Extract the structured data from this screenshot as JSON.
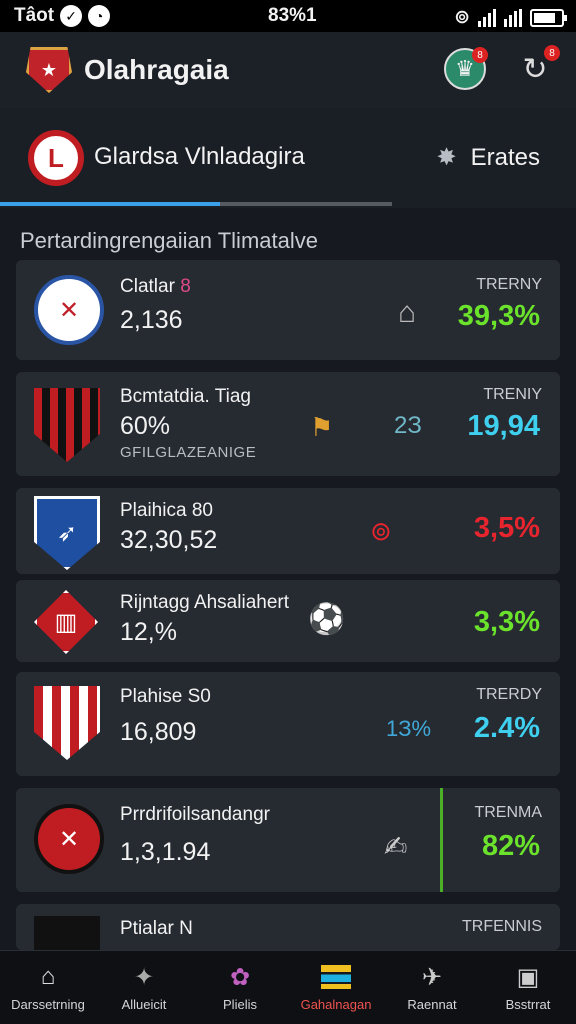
{
  "status": {
    "left_text": "Tâot",
    "time": "83%1"
  },
  "app": {
    "title": "Olahragaia"
  },
  "league": {
    "logo_letter": "L",
    "name": "Glardsa Vlnladagira",
    "extra_label": "Erates"
  },
  "section": {
    "title": "Pertardingrengaiian Tlimatalve"
  },
  "teams": [
    {
      "name": "Clatlar",
      "name_num": "8",
      "value": "2,136",
      "sub": "",
      "mid": "",
      "trend_label": "TRERNY",
      "trend_value": "39,3%",
      "trend_color": "#6be22b"
    },
    {
      "name": "Bcmtatdia. Tiag",
      "name_num": "",
      "value": "60%",
      "sub": "GFILGLAZEANIGE",
      "mid": "2З",
      "trend_label": "TRENIY",
      "trend_value": "19,94",
      "trend_color": "#3fd0f0"
    },
    {
      "name": "Plaihica",
      "name_num": "80",
      "value": "32,30,52",
      "sub": "",
      "mid": "",
      "trend_label": "",
      "trend_value": "3,5%",
      "trend_color": "#e8242e"
    },
    {
      "name": "Rijntagg Ahsaliahert",
      "name_num": "",
      "value": "12,%",
      "sub": "",
      "mid": "",
      "trend_label": "",
      "trend_value": "3,3%",
      "trend_color": "#6be22b"
    },
    {
      "name": "Plahise",
      "name_num": "S0",
      "value": "16,809",
      "sub": "",
      "mid": "1З%",
      "trend_label": "TRERDY",
      "trend_value": "2.4%",
      "trend_color": "#3fd0f0"
    },
    {
      "name": "Prrdrifoilsandangr",
      "name_num": "",
      "value": "1,3,1.94",
      "sub": "",
      "mid": "",
      "trend_label": "TRENMA",
      "trend_value": "82%",
      "trend_color": "#6be22b"
    },
    {
      "name": "Ptialar",
      "name_num": "N",
      "value": "",
      "sub": "",
      "mid": "",
      "trend_label": "TRFENNIS",
      "trend_value": "",
      "trend_color": "#6be22b"
    }
  ],
  "nav": [
    {
      "label": "Darssetrning",
      "icon": "home-icon"
    },
    {
      "label": "Allueicit",
      "icon": "players-icon"
    },
    {
      "label": "Plielis",
      "icon": "stats-icon"
    },
    {
      "label": "Gahalnagan",
      "icon": "standings-icon"
    },
    {
      "label": "Raennat",
      "icon": "news-icon"
    },
    {
      "label": "Bsstrrat",
      "icon": "settings-icon"
    }
  ]
}
